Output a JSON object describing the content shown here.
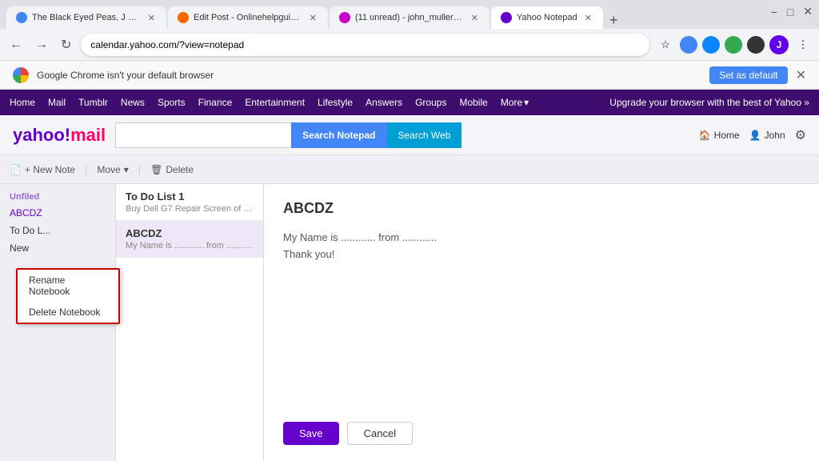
{
  "browser": {
    "tabs": [
      {
        "id": "tab1",
        "title": "The Black Eyed Peas, J Balvi...",
        "favicon_color": "#4285f4",
        "active": false
      },
      {
        "id": "tab2",
        "title": "Edit Post - Onlinehelpguide —...",
        "favicon_color": "#ff6600",
        "active": false
      },
      {
        "id": "tab3",
        "title": "(11 unread) - john_muller95@y...",
        "favicon_color": "#cc00cc",
        "active": false
      },
      {
        "id": "tab4",
        "title": "Yahoo Notepad",
        "favicon_color": "#6600cc",
        "active": true
      }
    ],
    "address": "calendar.yahoo.com/?view=notepad",
    "nav": {
      "back": "←",
      "forward": "→",
      "refresh": "↻"
    },
    "window_controls": {
      "minimize": "−",
      "maximize": "□",
      "close": "✕"
    }
  },
  "banner": {
    "text": "Google Chrome isn't your default browser",
    "button": "Set as default",
    "close": "✕"
  },
  "yahoo_nav": {
    "items": [
      "Home",
      "Mail",
      "Tumblr",
      "News",
      "Sports",
      "Finance",
      "Entertainment",
      "Lifestyle",
      "Answers",
      "Groups",
      "Mobile"
    ],
    "more": "More",
    "upgrade": "Upgrade your browser with the best of Yahoo »"
  },
  "header": {
    "logo_yahoo": "yahoo!",
    "logo_mail": "mail",
    "search_placeholder": "",
    "search_notepad": "Search Notepad",
    "search_web": "Search Web",
    "home": "Home",
    "user": "John",
    "home_icon": "🏠",
    "user_icon": "👤",
    "settings_icon": "⚙"
  },
  "toolbar": {
    "new_note": "+ New Note",
    "move": "Move",
    "delete": "Delete",
    "move_icon": "▾",
    "note_icon": "📄",
    "trash_icon": "🗑"
  },
  "sidebar": {
    "unfiled_label": "Unfiled",
    "items": [
      {
        "id": "abcdz",
        "label": "ABCDZ"
      },
      {
        "id": "todo",
        "label": "To Do L..."
      },
      {
        "id": "new",
        "label": "New"
      }
    ]
  },
  "context_menu": {
    "items": [
      {
        "id": "rename",
        "label": "Rename Notebook"
      },
      {
        "id": "delete",
        "label": "Delete Notebook"
      }
    ]
  },
  "notes": {
    "sections": [
      {
        "id": "todo",
        "notes": [
          {
            "id": "todo1",
            "title": "To Do List 1",
            "preview": "Buy Dell G7 Repair Screen of D...",
            "active": false
          }
        ]
      },
      {
        "id": "abcdz",
        "notes": [
          {
            "id": "abcdz1",
            "title": "ABCDZ",
            "preview": "My Name is ............ from ............",
            "active": true
          }
        ]
      }
    ]
  },
  "editor": {
    "title": "ABCDZ",
    "body": "My Name is ............ from ............\nThank you!",
    "save_label": "Save",
    "cancel_label": "Cancel"
  }
}
